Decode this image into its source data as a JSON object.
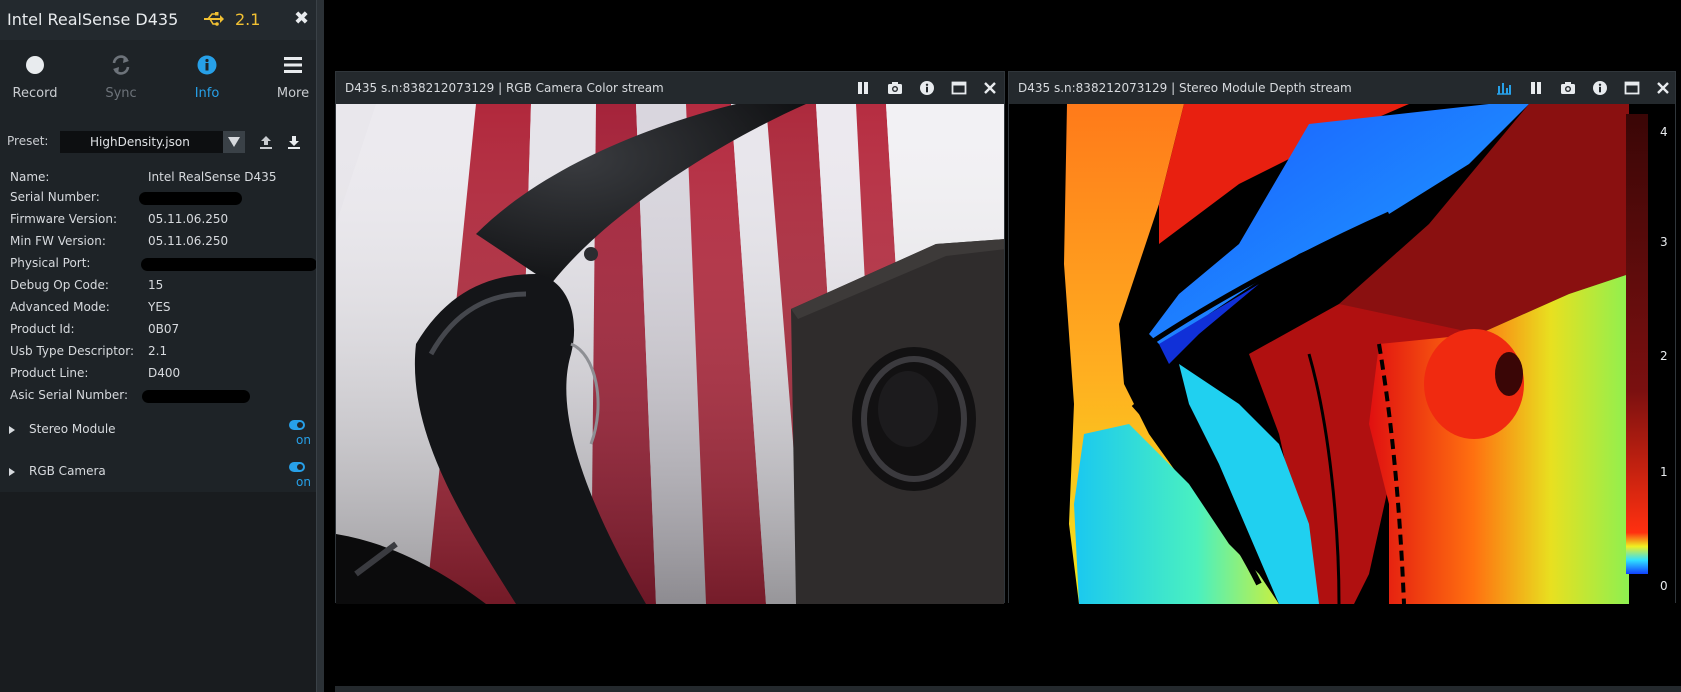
{
  "device": {
    "name": "Intel RealSense D435",
    "usb_version": "2.1",
    "close_icon": "close-icon"
  },
  "toolbar": [
    {
      "label": "Record",
      "icon": "record-icon"
    },
    {
      "label": "Sync",
      "icon": "sync-icon"
    },
    {
      "label": "Info",
      "icon": "info-icon"
    },
    {
      "label": "More",
      "icon": "menu-icon"
    }
  ],
  "preset": {
    "label": "Preset:",
    "value": "HighDensity.json"
  },
  "info": {
    "name": {
      "key": "Name:",
      "value": "Intel RealSense D435"
    },
    "serial": {
      "key": "Serial Number:",
      "value": ""
    },
    "firmware": {
      "key": "Firmware Version:",
      "value": "05.11.06.250"
    },
    "min_fw": {
      "key": "Min FW Version:",
      "value": "05.11.06.250"
    },
    "port": {
      "key": "Physical Port:",
      "value": ""
    },
    "debug_op": {
      "key": "Debug Op Code:",
      "value": "15"
    },
    "advanced": {
      "key": "Advanced Mode:",
      "value": "YES"
    },
    "product_id": {
      "key": "Product Id:",
      "value": "0B07"
    },
    "usb_desc": {
      "key": "Usb Type Descriptor:",
      "value": "2.1"
    },
    "product_line": {
      "key": "Product Line:",
      "value": "D400"
    },
    "asic_serial": {
      "key": "Asic Serial Number:",
      "value": ""
    }
  },
  "modules": [
    {
      "name": "Stereo Module",
      "state": "on"
    },
    {
      "name": "RGB Camera",
      "state": "on"
    }
  ],
  "streams": {
    "rgb": {
      "title": "D435 s.n:838212073129 | RGB Camera Color stream"
    },
    "depth": {
      "title": "D435 s.n:838212073129 | Stereo Module Depth stream",
      "scale_ticks": [
        "4",
        "3",
        "2",
        "1",
        "0"
      ]
    }
  },
  "colors": {
    "accent": "#27a0e8",
    "usb": "#f2c133",
    "panel": "#1e2327"
  }
}
